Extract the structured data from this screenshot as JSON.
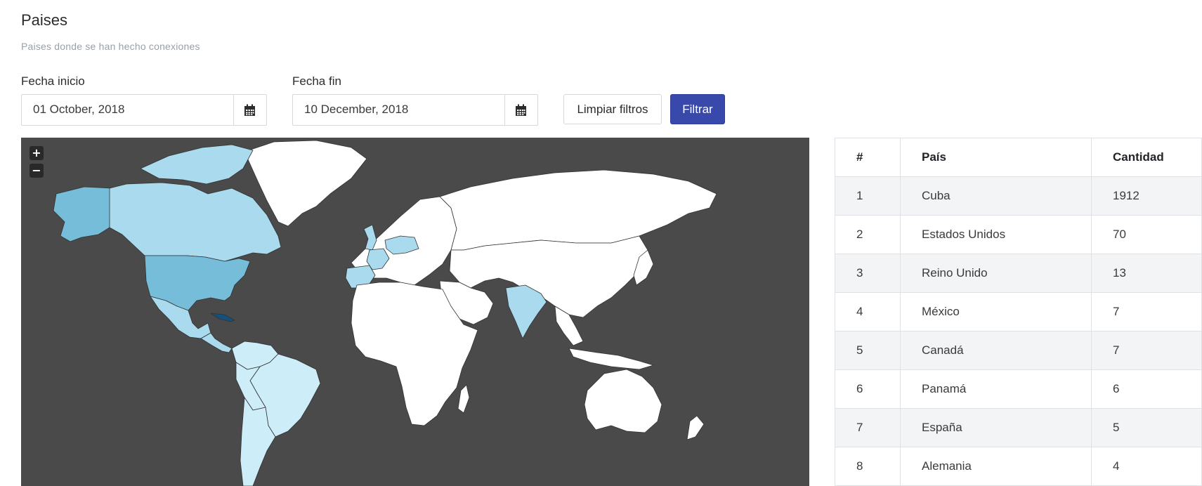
{
  "header": {
    "title": "Paises",
    "subtitle": "Paises donde se han hecho conexiones"
  },
  "filters": {
    "start_label": "Fecha inicio",
    "start_value": "01 October, 2018",
    "end_label": "Fecha fin",
    "end_value": "10 December, 2018",
    "calendar_icon": "calendar-icon",
    "clear_label": "Limpiar filtros",
    "filter_label": "Filtrar"
  },
  "map": {
    "zoom_in": "+",
    "zoom_out": "−",
    "colors": {
      "background": "#4a4a4a",
      "no_data": "#ffffff",
      "high": "#15507a",
      "medium": "#76bdd9",
      "low": "#a9daee",
      "lowest": "#cdedf9",
      "border": "#333333"
    }
  },
  "table": {
    "headers": [
      "#",
      "País",
      "Cantidad"
    ],
    "rows": [
      [
        "1",
        "Cuba",
        "1912"
      ],
      [
        "2",
        "Estados Unidos",
        "70"
      ],
      [
        "3",
        "Reino Unido",
        "13"
      ],
      [
        "4",
        "México",
        "7"
      ],
      [
        "5",
        "Canadá",
        "7"
      ],
      [
        "6",
        "Panamá",
        "6"
      ],
      [
        "7",
        "España",
        "5"
      ],
      [
        "8",
        "Alemania",
        "4"
      ]
    ]
  },
  "colors": {
    "primary": "#3949ab"
  }
}
